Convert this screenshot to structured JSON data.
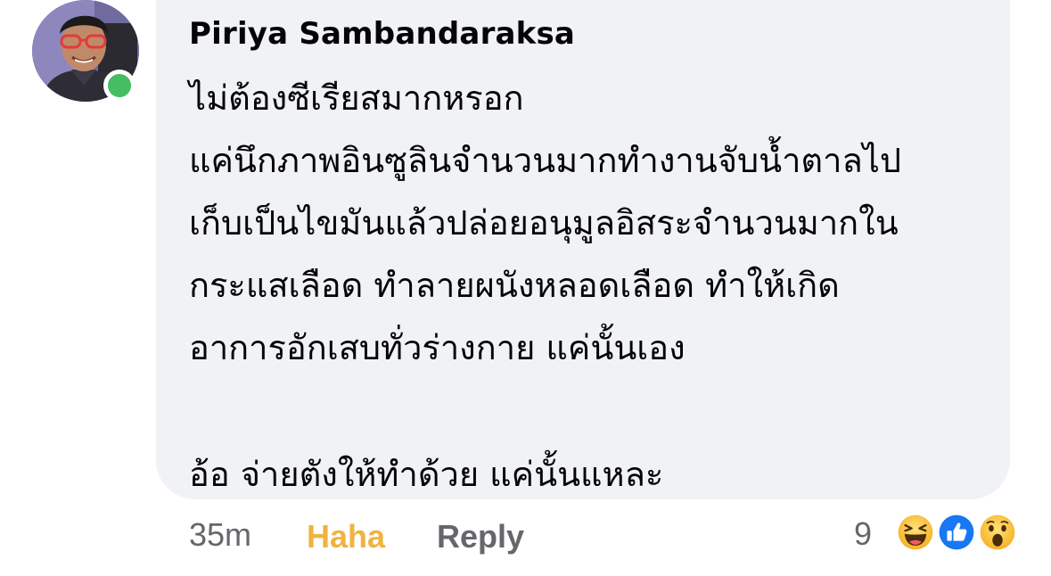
{
  "comment": {
    "author": "Piriya Sambandaraksa",
    "lines": [
      "ไม่ต้องซีเรียสมากหรอก",
      "แค่นึกภาพอินซูลินจำนวนมากทำงานจับน้ำตาลไป",
      "เก็บเป็นไขมันแล้วปล่อยอนุมูลอิสระจำนวนมากใน",
      "กระแสเลือด ทำลายผนังหลอดเลือด ทำให้เกิด",
      "อาการอักเสบทั่วร่างกาย แค่นั้นเอง",
      "",
      "อ้อ จ่ายตังให้ทำด้วย แค่นั้นแหละ"
    ],
    "online": true
  },
  "actions": {
    "timestamp": "35m",
    "reaction_label": "Haha",
    "reply_label": "Reply"
  },
  "reactions": {
    "count": "9",
    "icons": [
      "haha-icon",
      "like-icon",
      "wow-icon"
    ]
  },
  "colors": {
    "bubble": "#f0f2f5",
    "haha_active": "#f0b340",
    "secondary_text": "#65676b",
    "online": "#45bd62",
    "like_blue": "#1877f2"
  }
}
